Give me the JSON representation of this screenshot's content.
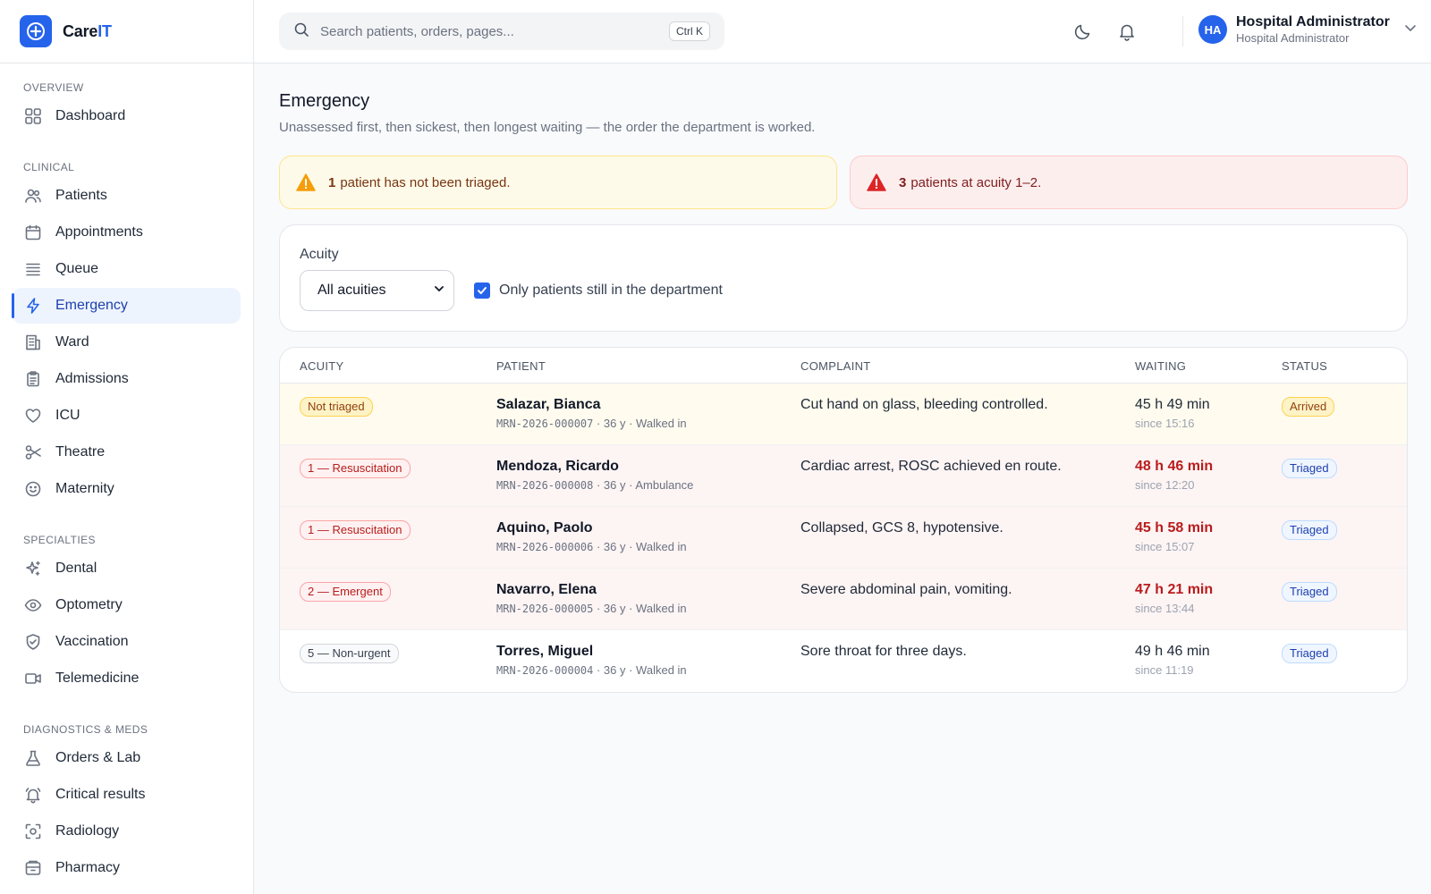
{
  "brand": {
    "name_a": "Care",
    "name_b": "IT"
  },
  "sidebar": {
    "sections": [
      {
        "label": "OVERVIEW",
        "items": [
          {
            "label": "Dashboard",
            "icon": "grid-icon"
          }
        ]
      },
      {
        "label": "CLINICAL",
        "items": [
          {
            "label": "Patients",
            "icon": "users-icon"
          },
          {
            "label": "Appointments",
            "icon": "calendar-icon"
          },
          {
            "label": "Queue",
            "icon": "list-icon"
          },
          {
            "label": "Emergency",
            "icon": "bolt-icon",
            "active": true
          },
          {
            "label": "Ward",
            "icon": "building-icon"
          },
          {
            "label": "Admissions",
            "icon": "clipboard-icon"
          },
          {
            "label": "ICU",
            "icon": "heart-icon"
          },
          {
            "label": "Theatre",
            "icon": "scissors-icon"
          },
          {
            "label": "Maternity",
            "icon": "smile-icon"
          }
        ]
      },
      {
        "label": "SPECIALTIES",
        "items": [
          {
            "label": "Dental",
            "icon": "sparkle-icon"
          },
          {
            "label": "Optometry",
            "icon": "eye-icon"
          },
          {
            "label": "Vaccination",
            "icon": "shield-icon"
          },
          {
            "label": "Telemedicine",
            "icon": "video-icon"
          }
        ]
      },
      {
        "label": "DIAGNOSTICS & MEDS",
        "items": [
          {
            "label": "Orders & Lab",
            "icon": "flask-icon"
          },
          {
            "label": "Critical results",
            "icon": "bell-alert-icon"
          },
          {
            "label": "Radiology",
            "icon": "scan-icon"
          },
          {
            "label": "Pharmacy",
            "icon": "box-icon"
          }
        ]
      }
    ]
  },
  "topbar": {
    "search_placeholder": "Search patients, orders, pages...",
    "shortcut": "Ctrl K",
    "user": {
      "initials": "HA",
      "name": "Hospital Administrator",
      "role": "Hospital Administrator"
    }
  },
  "page": {
    "title": "Emergency",
    "subtitle": "Unassessed first, then sickest, then longest waiting — the order the department is worked."
  },
  "alerts": {
    "untriaged": {
      "count": "1",
      "text": "patient has not been triaged."
    },
    "acuity": {
      "count": "3",
      "text": "patients at acuity 1–2."
    }
  },
  "filters": {
    "acuity_label": "Acuity",
    "acuity_value": "All acuities",
    "only_in_dept_label": "Only patients still in the department",
    "only_in_dept_checked": true
  },
  "table": {
    "headers": {
      "acuity": "ACUITY",
      "patient": "PATIENT",
      "complaint": "COMPLAINT",
      "waiting": "WAITING",
      "status": "STATUS"
    },
    "rows": [
      {
        "acuity": "Not triaged",
        "acuity_tone": "amber",
        "row_tone": "warn",
        "name": "Salazar, Bianca",
        "mrn": "MRN-2026-000007",
        "meta": " · 36 y · Walked in",
        "complaint": "Cut hand on glass, bleeding controlled.",
        "waiting": "45 h 49 min",
        "waiting_hot": false,
        "since": "since 15:16",
        "status": "Arrived",
        "status_tone": "amber"
      },
      {
        "acuity": "1 — Resuscitation",
        "acuity_tone": "red",
        "row_tone": "danger",
        "name": "Mendoza, Ricardo",
        "mrn": "MRN-2026-000008",
        "meta": " · 36 y · Ambulance",
        "complaint": "Cardiac arrest, ROSC achieved en route.",
        "waiting": "48 h 46 min",
        "waiting_hot": true,
        "since": "since 12:20",
        "status": "Triaged",
        "status_tone": "blue"
      },
      {
        "acuity": "1 — Resuscitation",
        "acuity_tone": "red",
        "row_tone": "danger",
        "name": "Aquino, Paolo",
        "mrn": "MRN-2026-000006",
        "meta": " · 36 y · Walked in",
        "complaint": "Collapsed, GCS 8, hypotensive.",
        "waiting": "45 h 58 min",
        "waiting_hot": true,
        "since": "since 15:07",
        "status": "Triaged",
        "status_tone": "blue"
      },
      {
        "acuity": "2 — Emergent",
        "acuity_tone": "red",
        "row_tone": "danger",
        "name": "Navarro, Elena",
        "mrn": "MRN-2026-000005",
        "meta": " · 36 y · Walked in",
        "complaint": "Severe abdominal pain, vomiting.",
        "waiting": "47 h 21 min",
        "waiting_hot": true,
        "since": "since 13:44",
        "status": "Triaged",
        "status_tone": "blue"
      },
      {
        "acuity": "5 — Non-urgent",
        "acuity_tone": "gray",
        "row_tone": "none",
        "name": "Torres, Miguel",
        "mrn": "MRN-2026-000004",
        "meta": " · 36 y · Walked in",
        "complaint": "Sore throat for three days.",
        "waiting": "49 h 46 min",
        "waiting_hot": false,
        "since": "since 11:19",
        "status": "Triaged",
        "status_tone": "blue"
      }
    ]
  }
}
